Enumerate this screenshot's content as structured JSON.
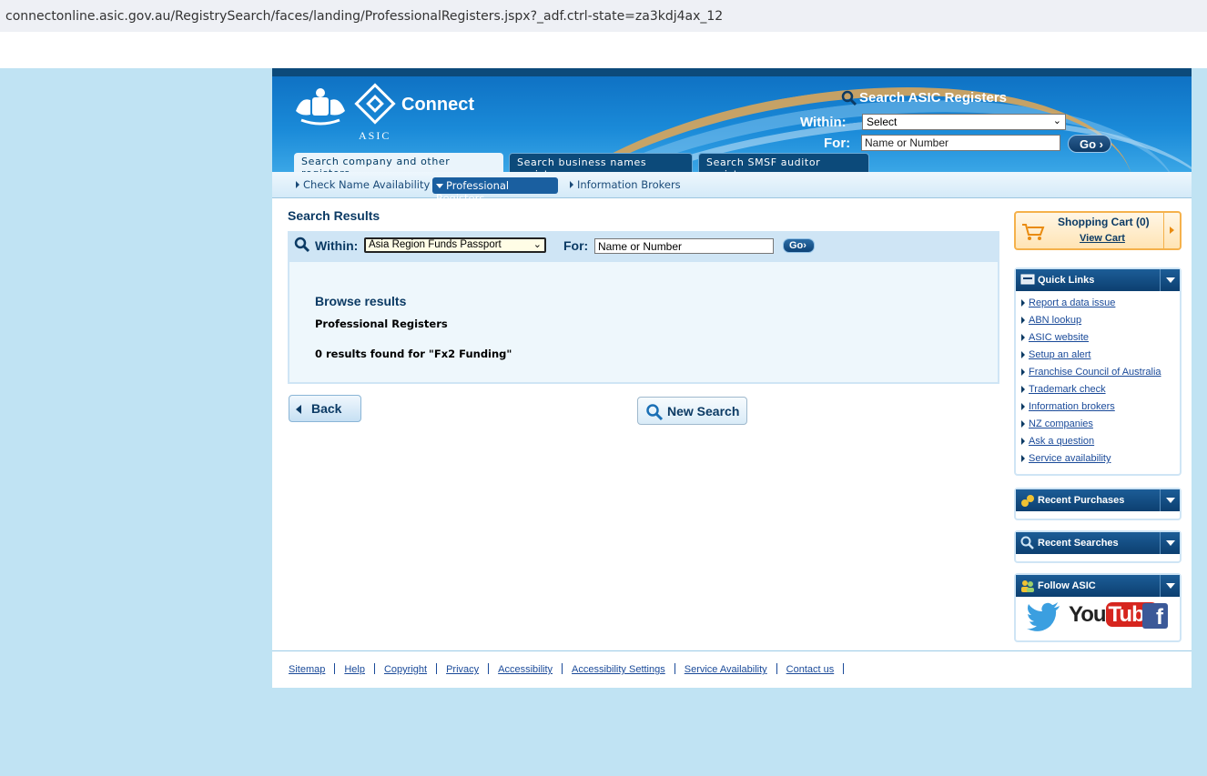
{
  "browser": {
    "url": "connectonline.asic.gov.au/RegistrySearch/faces/landing/ProfessionalRegisters.jspx?_adf.ctrl-state=za3kdj4ax_12"
  },
  "header": {
    "asic_label": "ASIC",
    "brand": "Connect",
    "search_title": "Search ASIC Registers",
    "within_label": "Within:",
    "within_value": "Select",
    "for_label": "For:",
    "for_placeholder": "Name or Number",
    "go_label": "Go"
  },
  "tabs": [
    {
      "label": "Search company and other registers",
      "active": true
    },
    {
      "label": "Search business names register",
      "active": false
    },
    {
      "label": "Search SMSF auditor register",
      "active": false
    }
  ],
  "subnav": {
    "items": [
      "Check Name Availability",
      "Professional Registers",
      "Information Brokers"
    ],
    "active_index": 1
  },
  "main": {
    "title": "Search Results",
    "within_label": "Within:",
    "within_value": "Asia Region Funds Passport",
    "for_label": "For:",
    "for_placeholder": "Name or Number",
    "go_label": "Go",
    "browse_title": "Browse results",
    "browse_subtitle": "Professional Registers",
    "result_text": "0 results found for \"Fx2 Funding\"",
    "back_label": "Back",
    "new_search_label": "New Search"
  },
  "sidebar": {
    "cart_title": "Shopping Cart (0)",
    "cart_link": "View Cart",
    "quick_links_title": "Quick Links",
    "quick_links": [
      "Report a data issue",
      "ABN lookup",
      "ASIC website",
      "Setup an alert",
      "Franchise Council of Australia",
      "Trademark check",
      "Information brokers",
      "NZ companies",
      "Ask a question",
      "Service availability"
    ],
    "recent_purchases_title": "Recent Purchases",
    "recent_searches_title": "Recent Searches",
    "follow_title": "Follow ASIC",
    "youtube_you": "You",
    "youtube_tube": "Tube",
    "facebook_letter": "f"
  },
  "footer": {
    "links": [
      "Sitemap",
      "Help",
      "Copyright",
      "Privacy",
      "Accessibility",
      "Accessibility Settings",
      "Service Availability",
      "Contact us"
    ]
  },
  "colors": {
    "page_bg": "#c0e3f3",
    "header_blue": "#1a8ad8",
    "navy": "#0b3a64",
    "cart_orange": "#f5b14b"
  }
}
